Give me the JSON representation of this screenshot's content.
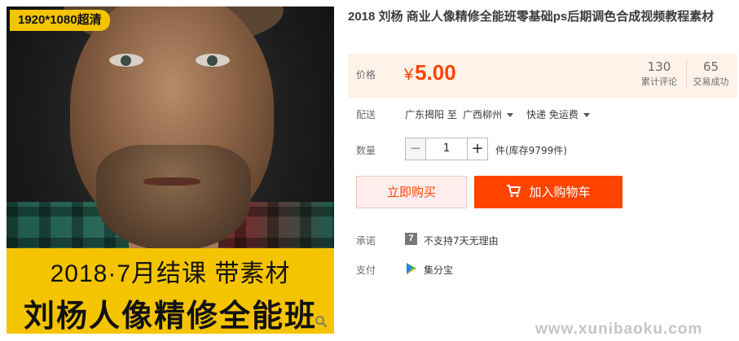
{
  "image": {
    "resolution_badge": "1920*1080超清",
    "banner_line1": "2018·7月结课 带素材",
    "banner_line2": "刘杨人像精修全能班",
    "zoom_icon": "zoom-icon"
  },
  "product": {
    "title": "2018 刘杨 商业人像精修全能班零基础ps后期调色合成视频教程素材"
  },
  "price": {
    "label": "价格",
    "currency": "¥",
    "value": "5.00",
    "reviews_count": "130",
    "reviews_label": "累计评论",
    "sales_count": "65",
    "sales_label": "交易成功"
  },
  "shipping": {
    "label": "配送",
    "from": "广东揭阳 至",
    "to": "广西柳州",
    "method": "快递 免运费"
  },
  "quantity": {
    "label": "数量",
    "minus": "−",
    "value": "1",
    "plus": "+",
    "stock": "件(库存9799件)"
  },
  "actions": {
    "buy_now": "立即购买",
    "add_to_cart": "加入购物车"
  },
  "promise": {
    "label": "承诺",
    "icon_text": "7",
    "text": "不支持7天无理由"
  },
  "payment": {
    "label": "支付",
    "text": "集分宝"
  },
  "watermark": "www.xunibaoku.com",
  "colors": {
    "accent": "#ff4400",
    "price_bg": "#fff2e8",
    "banner": "#f5c400"
  }
}
